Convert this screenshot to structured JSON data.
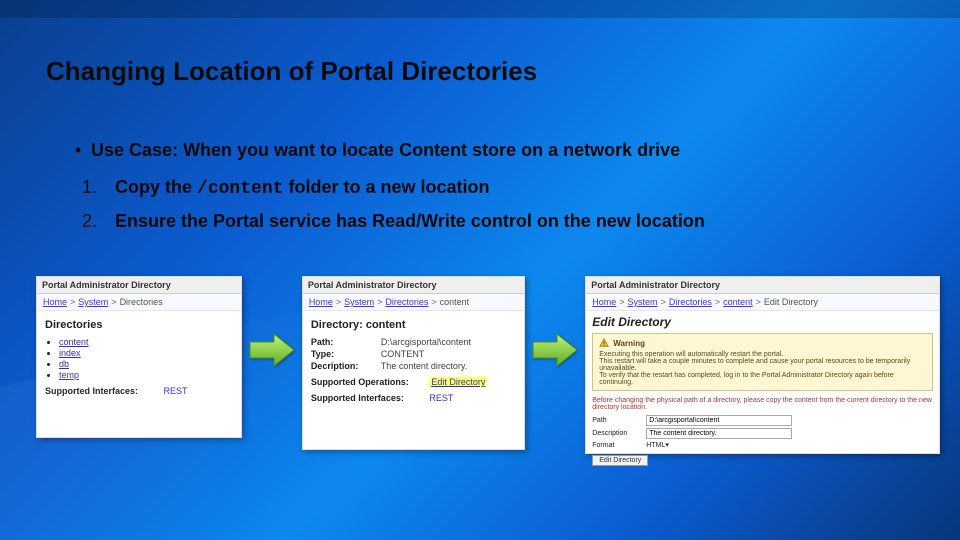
{
  "title": "Changing Location of Portal Directories",
  "bullet": {
    "prefix": "Use Case:",
    "text": " When you want to locate Content store on a network drive"
  },
  "steps": [
    {
      "num": "1.",
      "before": "Copy the ",
      "code": "/content",
      "after": " folder to a new location"
    },
    {
      "num": "2.",
      "text": "Ensure the Portal service has Read/Write control on the new location"
    }
  ],
  "panel1": {
    "bar": "Portal Administrator Directory",
    "crumbs": {
      "home": "Home",
      "l1": "System",
      "current": "Directories"
    },
    "heading": "Directories",
    "items": [
      "content",
      "index",
      "db",
      "temp"
    ],
    "supported": {
      "label": "Supported Interfaces:",
      "value": "REST"
    }
  },
  "panel2": {
    "bar": "Portal Administrator Directory",
    "crumbs": {
      "home": "Home",
      "l1": "System",
      "l2": "Directories",
      "current": "content"
    },
    "heading": "Directory: content",
    "rows": [
      {
        "k": "Path:",
        "v": "D:\\arcgisportal\\content"
      },
      {
        "k": "Type:",
        "v": "CONTENT"
      },
      {
        "k": "Decription:",
        "v": "The content directory."
      }
    ],
    "ops": {
      "label": "Supported Operations:",
      "value": "Edit Directory"
    },
    "supported": {
      "label": "Supported Interfaces:",
      "value": "REST"
    }
  },
  "panel3": {
    "bar": "Portal Administrator Directory",
    "crumbs": {
      "home": "Home",
      "l1": "System",
      "l2": "Directories",
      "l3": "content",
      "current": "Edit Directory"
    },
    "heading": "Edit Directory",
    "warning": {
      "title": "Warning",
      "line1": "Executing this operation will automatically restart the portal.",
      "line2": "This restart will take a couple minutes to complete and cause your portal resources to be temporarily unavailable.",
      "line3": "To verify that the restart has completed, log in to the Portal Administrator Directory again before continuing."
    },
    "redtext": "Before changing the physical path of a directory, please copy the content from the current directory to the new directory location.",
    "form": {
      "path": {
        "label": "Path",
        "value": "D:\\arcgisportal\\content"
      },
      "desc": {
        "label": "Description",
        "value": "The content directory."
      },
      "format": {
        "label": "Format",
        "value": "HTML"
      }
    },
    "button": "Edit Directory"
  }
}
